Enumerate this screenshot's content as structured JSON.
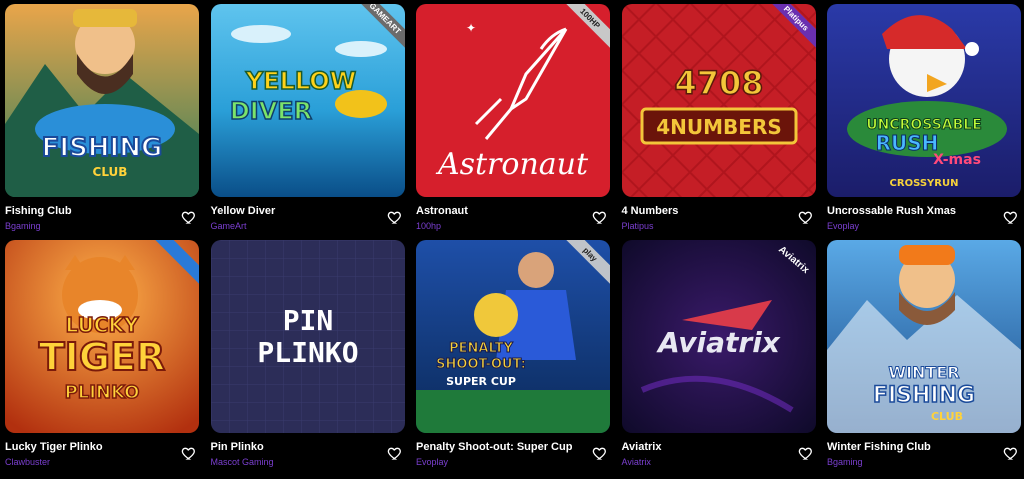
{
  "games": [
    {
      "title": "Fishing Club",
      "provider": "Bgaming",
      "art": "FISHING",
      "art2": "CLUB",
      "badge": ""
    },
    {
      "title": "Yellow Diver",
      "provider": "GameArt",
      "art": "YELLOW",
      "art2": "DIVER",
      "badge": "GAMEART"
    },
    {
      "title": "Astronaut",
      "provider": "100hp",
      "art": "Astronaut",
      "art2": "",
      "badge": "100HP"
    },
    {
      "title": "4 Numbers",
      "provider": "Platipus",
      "art": "4708",
      "art2": "4NUMBERS",
      "badge": "Platipus"
    },
    {
      "title": "Uncrossable Rush Xmas",
      "provider": "Evoplay",
      "art": "UNCROSSABLE",
      "art2": "RUSH",
      "art3": "X-mas",
      "art4": "CROSSYRUN",
      "badge": ""
    },
    {
      "title": "Lucky Tiger Plinko",
      "provider": "Clawbuster",
      "art": "LUCKY",
      "art2": "TIGER",
      "art3": "PLINKO",
      "badge": ""
    },
    {
      "title": "Pin Plinko",
      "provider": "Mascot Gaming",
      "art": "PIN",
      "art2": "PLINKO",
      "badge": ""
    },
    {
      "title": "Penalty Shoot-out: Super Cup",
      "provider": "Evoplay",
      "art": "PENALTY",
      "art2": "SHOOT-OUT:",
      "art3": "SUPER CUP",
      "badge": "play"
    },
    {
      "title": "Aviatrix",
      "provider": "Aviatrix",
      "art": "Aviatrix",
      "art2": "",
      "badge": "Aviatrix"
    },
    {
      "title": "Winter Fishing Club",
      "provider": "Bgaming",
      "art": "WINTER",
      "art2": "FISHING",
      "art3": "CLUB",
      "badge": ""
    }
  ],
  "colors": {
    "provider_text": "#7b3fd0",
    "background": "#000000"
  },
  "icons": {
    "favorite": "heart-outline-icon"
  }
}
